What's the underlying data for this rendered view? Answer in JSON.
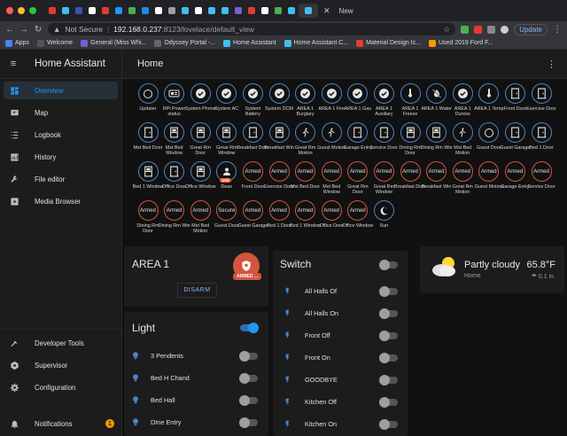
{
  "browser": {
    "tab_active_label": "H",
    "new_tab_label": "New",
    "security_label": "Not Secure",
    "url_host": "192.168.0.237",
    "url_path": ":8123/lovelace/default_view",
    "update_label": "Update",
    "bookmarks": [
      {
        "label": "Apps",
        "color": "#4285f4"
      },
      {
        "label": "Welcome",
        "color": "#555555"
      },
      {
        "label": "General (Miss Whi...",
        "color": "#7b5cd6"
      },
      {
        "label": "Odyssey Portal -...",
        "color": "#666666"
      },
      {
        "label": "Home Assistant",
        "color": "#41bdf5"
      },
      {
        "label": "Home Assistant C...",
        "color": "#41bdf5"
      },
      {
        "label": "Material Design Ic...",
        "color": "#e53935"
      },
      {
        "label": "Used 2019 Ford F...",
        "color": "#ff9800"
      }
    ]
  },
  "sidebar": {
    "title": "Home Assistant",
    "items": [
      {
        "label": "Overview",
        "icon": "dashboard-icon",
        "selected": true
      },
      {
        "label": "Map",
        "icon": "map-icon"
      },
      {
        "label": "Logbook",
        "icon": "logbook-icon"
      },
      {
        "label": "History",
        "icon": "history-icon"
      },
      {
        "label": "File editor",
        "icon": "wrench-icon"
      },
      {
        "label": "Media Browser",
        "icon": "media-icon"
      }
    ],
    "bottom_items": [
      {
        "label": "Developer Tools",
        "icon": "hammer-icon"
      },
      {
        "label": "Supervisor",
        "icon": "supervisor-icon"
      },
      {
        "label": "Configuration",
        "icon": "gear-icon"
      }
    ],
    "notifications_label": "Notifications",
    "notifications_count": "1"
  },
  "header": {
    "title": "Home"
  },
  "badges": [
    [
      {
        "label": "Updater",
        "kind": "icon",
        "icon": "updater-icon"
      },
      {
        "label": "RPi Power status",
        "kind": "icon",
        "icon": "raspberry-icon"
      },
      {
        "label": "System Phone",
        "kind": "icon",
        "icon": "check-icon"
      },
      {
        "label": "System AC",
        "kind": "icon",
        "icon": "check-icon"
      },
      {
        "label": "System Battery",
        "kind": "icon",
        "icon": "check-icon"
      },
      {
        "label": "System DCM",
        "kind": "icon",
        "icon": "check-icon"
      },
      {
        "label": "AREA 1 Burglary",
        "kind": "icon",
        "icon": "check-icon"
      },
      {
        "label": "AREA 1 Fire",
        "kind": "icon",
        "icon": "check-icon"
      },
      {
        "label": "AREA 1 Gas",
        "kind": "icon",
        "icon": "check-icon"
      },
      {
        "label": "AREA 1 Auxiliary",
        "kind": "icon",
        "icon": "check-icon"
      },
      {
        "label": "AREA 1 Freeze",
        "kind": "icon",
        "icon": "thermometer-icon"
      },
      {
        "label": "AREA 1 Water",
        "kind": "icon",
        "icon": "water-off-icon"
      },
      {
        "label": "AREA 1 Duress",
        "kind": "icon",
        "icon": "check-icon"
      },
      {
        "label": "AREA 1 Temp",
        "kind": "icon",
        "icon": "thermometer-icon"
      },
      {
        "label": "Front Door",
        "kind": "icon",
        "icon": "door-icon"
      },
      {
        "label": "Exercise Door",
        "kind": "icon",
        "icon": "door-icon"
      }
    ],
    [
      {
        "label": "Mst Bed Door",
        "kind": "icon",
        "icon": "door-icon"
      },
      {
        "label": "Mst Bed Window",
        "kind": "icon",
        "icon": "window-icon"
      },
      {
        "label": "Great Rm Door",
        "kind": "icon",
        "icon": "window-icon"
      },
      {
        "label": "Great Rm Window",
        "kind": "icon",
        "icon": "window-icon"
      },
      {
        "label": "Breakfast Door",
        "kind": "icon",
        "icon": "door-icon"
      },
      {
        "label": "Breakfast Win",
        "kind": "icon",
        "icon": "window-icon"
      },
      {
        "label": "Great Rm Motion",
        "kind": "icon",
        "icon": "walk-icon"
      },
      {
        "label": "Guest Motion",
        "kind": "icon",
        "icon": "walk-icon"
      },
      {
        "label": "Garage Entry",
        "kind": "icon",
        "icon": "door-icon"
      },
      {
        "label": "Service Door",
        "kind": "icon",
        "icon": "door-icon"
      },
      {
        "label": "Dining Rm Door",
        "kind": "icon",
        "icon": "window-icon"
      },
      {
        "label": "Dining Rm Win",
        "kind": "icon",
        "icon": "window-icon"
      },
      {
        "label": "Mst Bed Motion",
        "kind": "icon",
        "icon": "walk-icon"
      },
      {
        "label": "Guest Door",
        "kind": "icon",
        "icon": "circle-outline-icon"
      },
      {
        "label": "Guest Garage",
        "kind": "icon",
        "icon": "door-icon"
      },
      {
        "label": "Bed 1 Door",
        "kind": "icon",
        "icon": "door-icon"
      }
    ],
    [
      {
        "label": "Bed 1 Window",
        "kind": "icon",
        "icon": "window-icon"
      },
      {
        "label": "Office Door",
        "kind": "icon",
        "icon": "door-icon"
      },
      {
        "label": "Office Window",
        "kind": "icon",
        "icon": "window-icon"
      },
      {
        "label": "Dean",
        "kind": "person",
        "icon": "person-icon",
        "tag": "Unk"
      },
      {
        "label": "Front Door",
        "kind": "text",
        "value": "Armed"
      },
      {
        "label": "Exercise Door",
        "kind": "text",
        "value": "Armed"
      },
      {
        "label": "Mst Bed Door",
        "kind": "text",
        "value": "Armed"
      },
      {
        "label": "Mst Bed Window",
        "kind": "text",
        "value": "Armed"
      },
      {
        "label": "Great Rm Door",
        "kind": "text",
        "value": "Armed"
      },
      {
        "label": "Great Rm Window",
        "kind": "text",
        "value": "Armed"
      },
      {
        "label": "Breakfast Door",
        "kind": "text",
        "value": "Armed"
      },
      {
        "label": "Breakfast Win",
        "kind": "text",
        "value": "Armed"
      },
      {
        "label": "Great Rm Motion",
        "kind": "text",
        "value": "Armed"
      },
      {
        "label": "Guest Motion",
        "kind": "text",
        "value": "Armed"
      },
      {
        "label": "Garage Entry",
        "kind": "text",
        "value": "Armed"
      },
      {
        "label": "Service Door",
        "kind": "text",
        "value": "Armed"
      }
    ],
    [
      {
        "label": "Dining Rm Door",
        "kind": "text",
        "value": "Armed"
      },
      {
        "label": "Dining Rm Win",
        "kind": "text",
        "value": "Armed"
      },
      {
        "label": "Mst Bed Motion",
        "kind": "text",
        "value": "Armed"
      },
      {
        "label": "Guest Door",
        "kind": "text",
        "value": "Secure"
      },
      {
        "label": "Guest Garage",
        "kind": "text",
        "value": "Armed"
      },
      {
        "label": "Bed 1 Door",
        "kind": "text",
        "value": "Armed"
      },
      {
        "label": "Bed 1 Window",
        "kind": "text",
        "value": "Armed"
      },
      {
        "label": "Office Door",
        "kind": "text",
        "value": "Armed"
      },
      {
        "label": "Office Window",
        "kind": "text",
        "value": "Armed"
      },
      {
        "label": "Sun",
        "kind": "icon",
        "icon": "moon-icon"
      }
    ]
  ],
  "alarm_card": {
    "title": "AREA 1",
    "state": "ARMED ...",
    "disarm_label": "DISARM"
  },
  "light_card": {
    "title": "Light",
    "master_on": true,
    "items": [
      {
        "label": "3 Pendents",
        "on": false
      },
      {
        "label": "Bed H Chand",
        "on": false
      },
      {
        "label": "Bed Hall",
        "on": false
      },
      {
        "label": "DIne Entry",
        "on": false
      }
    ]
  },
  "switch_card": {
    "title": "Switch",
    "master_on": false,
    "items": [
      {
        "label": "All Halls Of",
        "on": false
      },
      {
        "label": "All Halls On",
        "on": false
      },
      {
        "label": "Front Off",
        "on": false
      },
      {
        "label": "Front On",
        "on": false
      },
      {
        "label": "GOODBYE",
        "on": false
      },
      {
        "label": "Kitchen Off",
        "on": false
      },
      {
        "label": "Kitchen On",
        "on": false
      }
    ]
  },
  "weather_card": {
    "condition": "Partly cloudy",
    "location": "Home",
    "temperature": "65.8°F",
    "precipitation": "0.1 in"
  },
  "colors": {
    "accent": "#2196f3",
    "badge_border": "#4a86c8",
    "armed": "#d3553d",
    "warning": "#ff9800"
  }
}
